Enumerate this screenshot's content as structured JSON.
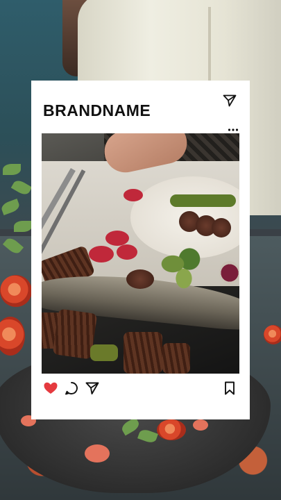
{
  "post": {
    "brand_name": "BRANDNAME",
    "icons": {
      "header_send": "send-icon",
      "more": "more-horizontal-icon",
      "like": "heart-icon",
      "comment": "comment-icon",
      "share": "send-icon",
      "save": "bookmark-icon"
    },
    "like_state": "liked"
  },
  "colors": {
    "like_red": "#e53a3f",
    "text": "#111111",
    "card_bg": "#ffffff"
  }
}
